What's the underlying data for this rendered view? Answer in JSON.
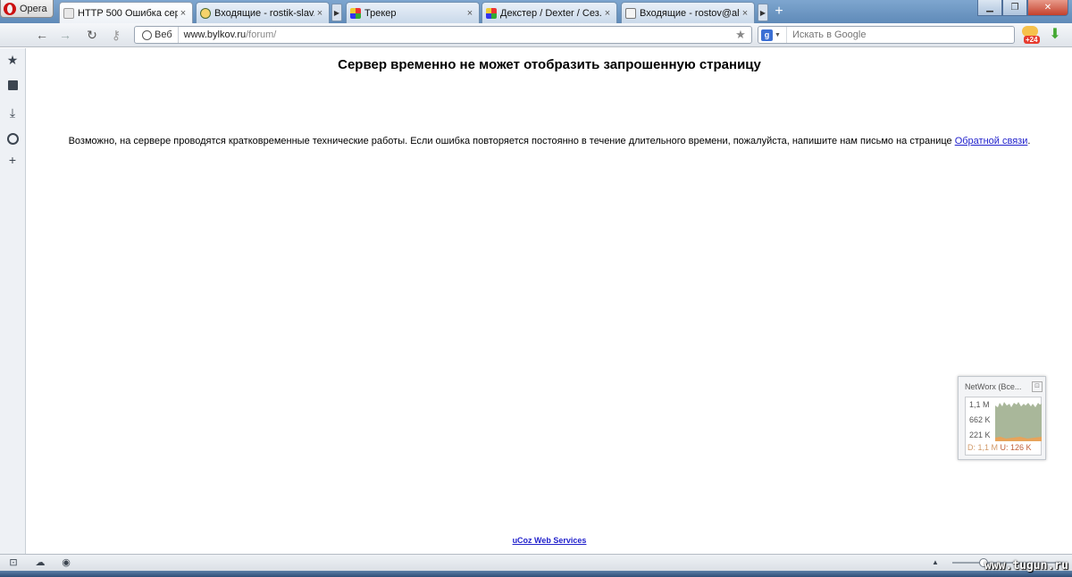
{
  "browser": {
    "menu_label": "Opera",
    "tabs": [
      {
        "label": "HTTP 500 Ошибка сер...",
        "active": true,
        "favicon": "page-icon"
      },
      {
        "label": "Входящие - rostik-slav...",
        "active": false,
        "favicon": "mail-icon"
      },
      {
        "label": "Трекер",
        "active": false,
        "favicon": "tracker-icon"
      },
      {
        "label": "Декстер / Dexter / Сез...",
        "active": false,
        "favicon": "tracker-icon"
      },
      {
        "label": "Входящие - rostov@alf...",
        "active": false,
        "favicon": "page-icon"
      }
    ],
    "close_glyph": "×",
    "new_tab_glyph": "+"
  },
  "toolbar": {
    "web_label": "Веб",
    "url_host": "www.bylkov.ru",
    "url_path": "/forum/",
    "search_placeholder": "Искать в Google",
    "search_engine_letter": "g",
    "weather_badge": "+24"
  },
  "page": {
    "title": "Сервер временно не может отобразить запрошенную страницу",
    "message_text": "Возможно, на сервере проводятся кратковременные технические работы. Если ошибка повторяется постоянно в течение длительного времени, пожалуйста, напишите нам письмо на странице ",
    "feedback_link": "Обратной связи",
    "message_end": ".",
    "footer_link": "uCoz Web Services"
  },
  "networx": {
    "title": "NetWorx (Все...",
    "close_glyph": "⊡",
    "ticks": [
      "1,1 M",
      "662 K",
      "221 K"
    ],
    "download_label": "D: 1,1 M",
    "upload_label": "U: 126 K"
  },
  "watermark": "www.tugun.ru",
  "colors": {
    "link": "#2222cc",
    "tabstrip": "#6f96c2",
    "traffic_download": "#a9b79a",
    "traffic_upload": "#e7a35a"
  }
}
